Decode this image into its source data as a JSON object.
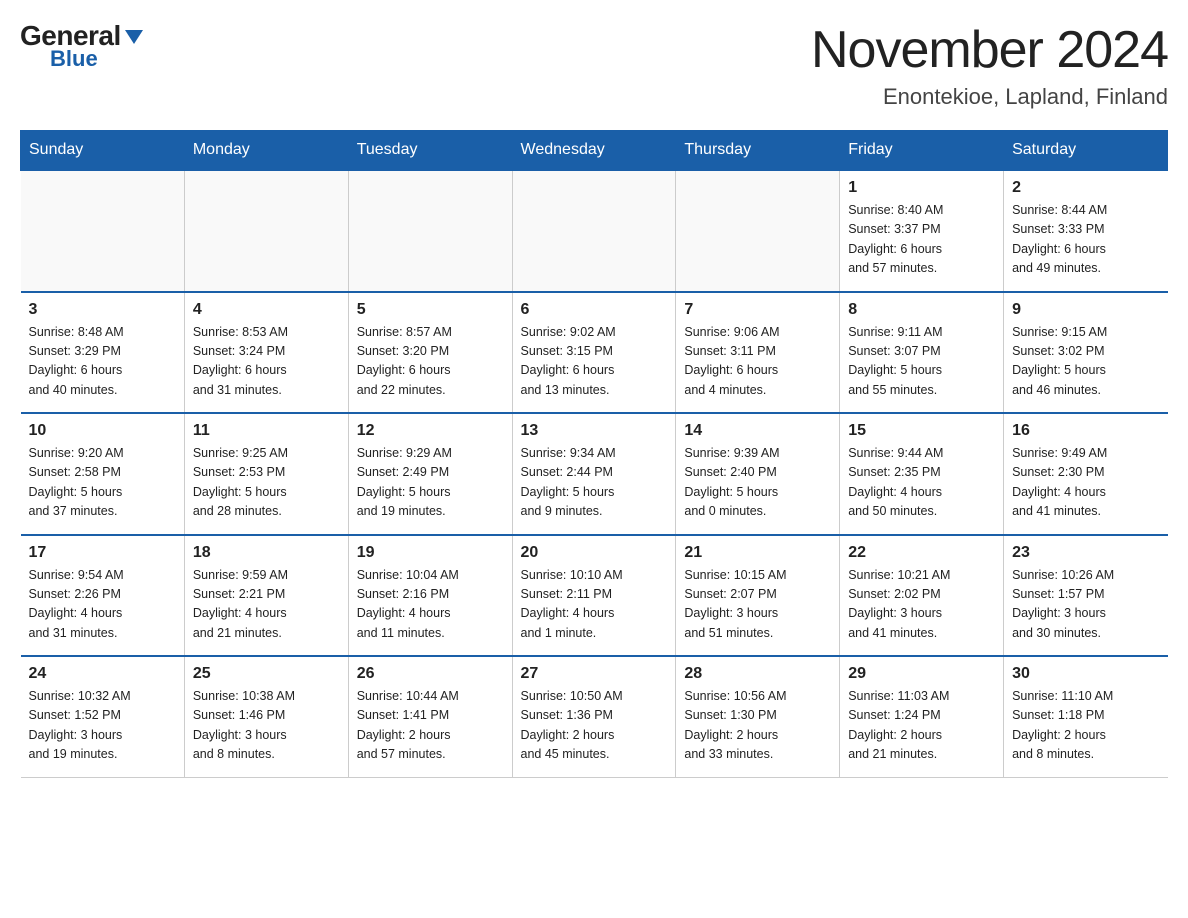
{
  "header": {
    "logo_general": "General",
    "logo_blue": "Blue",
    "title": "November 2024",
    "subtitle": "Enontekioe, Lapland, Finland"
  },
  "weekdays": [
    "Sunday",
    "Monday",
    "Tuesday",
    "Wednesday",
    "Thursday",
    "Friday",
    "Saturday"
  ],
  "weeks": [
    [
      {
        "day": "",
        "info": ""
      },
      {
        "day": "",
        "info": ""
      },
      {
        "day": "",
        "info": ""
      },
      {
        "day": "",
        "info": ""
      },
      {
        "day": "",
        "info": ""
      },
      {
        "day": "1",
        "info": "Sunrise: 8:40 AM\nSunset: 3:37 PM\nDaylight: 6 hours\nand 57 minutes."
      },
      {
        "day": "2",
        "info": "Sunrise: 8:44 AM\nSunset: 3:33 PM\nDaylight: 6 hours\nand 49 minutes."
      }
    ],
    [
      {
        "day": "3",
        "info": "Sunrise: 8:48 AM\nSunset: 3:29 PM\nDaylight: 6 hours\nand 40 minutes."
      },
      {
        "day": "4",
        "info": "Sunrise: 8:53 AM\nSunset: 3:24 PM\nDaylight: 6 hours\nand 31 minutes."
      },
      {
        "day": "5",
        "info": "Sunrise: 8:57 AM\nSunset: 3:20 PM\nDaylight: 6 hours\nand 22 minutes."
      },
      {
        "day": "6",
        "info": "Sunrise: 9:02 AM\nSunset: 3:15 PM\nDaylight: 6 hours\nand 13 minutes."
      },
      {
        "day": "7",
        "info": "Sunrise: 9:06 AM\nSunset: 3:11 PM\nDaylight: 6 hours\nand 4 minutes."
      },
      {
        "day": "8",
        "info": "Sunrise: 9:11 AM\nSunset: 3:07 PM\nDaylight: 5 hours\nand 55 minutes."
      },
      {
        "day": "9",
        "info": "Sunrise: 9:15 AM\nSunset: 3:02 PM\nDaylight: 5 hours\nand 46 minutes."
      }
    ],
    [
      {
        "day": "10",
        "info": "Sunrise: 9:20 AM\nSunset: 2:58 PM\nDaylight: 5 hours\nand 37 minutes."
      },
      {
        "day": "11",
        "info": "Sunrise: 9:25 AM\nSunset: 2:53 PM\nDaylight: 5 hours\nand 28 minutes."
      },
      {
        "day": "12",
        "info": "Sunrise: 9:29 AM\nSunset: 2:49 PM\nDaylight: 5 hours\nand 19 minutes."
      },
      {
        "day": "13",
        "info": "Sunrise: 9:34 AM\nSunset: 2:44 PM\nDaylight: 5 hours\nand 9 minutes."
      },
      {
        "day": "14",
        "info": "Sunrise: 9:39 AM\nSunset: 2:40 PM\nDaylight: 5 hours\nand 0 minutes."
      },
      {
        "day": "15",
        "info": "Sunrise: 9:44 AM\nSunset: 2:35 PM\nDaylight: 4 hours\nand 50 minutes."
      },
      {
        "day": "16",
        "info": "Sunrise: 9:49 AM\nSunset: 2:30 PM\nDaylight: 4 hours\nand 41 minutes."
      }
    ],
    [
      {
        "day": "17",
        "info": "Sunrise: 9:54 AM\nSunset: 2:26 PM\nDaylight: 4 hours\nand 31 minutes."
      },
      {
        "day": "18",
        "info": "Sunrise: 9:59 AM\nSunset: 2:21 PM\nDaylight: 4 hours\nand 21 minutes."
      },
      {
        "day": "19",
        "info": "Sunrise: 10:04 AM\nSunset: 2:16 PM\nDaylight: 4 hours\nand 11 minutes."
      },
      {
        "day": "20",
        "info": "Sunrise: 10:10 AM\nSunset: 2:11 PM\nDaylight: 4 hours\nand 1 minute."
      },
      {
        "day": "21",
        "info": "Sunrise: 10:15 AM\nSunset: 2:07 PM\nDaylight: 3 hours\nand 51 minutes."
      },
      {
        "day": "22",
        "info": "Sunrise: 10:21 AM\nSunset: 2:02 PM\nDaylight: 3 hours\nand 41 minutes."
      },
      {
        "day": "23",
        "info": "Sunrise: 10:26 AM\nSunset: 1:57 PM\nDaylight: 3 hours\nand 30 minutes."
      }
    ],
    [
      {
        "day": "24",
        "info": "Sunrise: 10:32 AM\nSunset: 1:52 PM\nDaylight: 3 hours\nand 19 minutes."
      },
      {
        "day": "25",
        "info": "Sunrise: 10:38 AM\nSunset: 1:46 PM\nDaylight: 3 hours\nand 8 minutes."
      },
      {
        "day": "26",
        "info": "Sunrise: 10:44 AM\nSunset: 1:41 PM\nDaylight: 2 hours\nand 57 minutes."
      },
      {
        "day": "27",
        "info": "Sunrise: 10:50 AM\nSunset: 1:36 PM\nDaylight: 2 hours\nand 45 minutes."
      },
      {
        "day": "28",
        "info": "Sunrise: 10:56 AM\nSunset: 1:30 PM\nDaylight: 2 hours\nand 33 minutes."
      },
      {
        "day": "29",
        "info": "Sunrise: 11:03 AM\nSunset: 1:24 PM\nDaylight: 2 hours\nand 21 minutes."
      },
      {
        "day": "30",
        "info": "Sunrise: 11:10 AM\nSunset: 1:18 PM\nDaylight: 2 hours\nand 8 minutes."
      }
    ]
  ]
}
